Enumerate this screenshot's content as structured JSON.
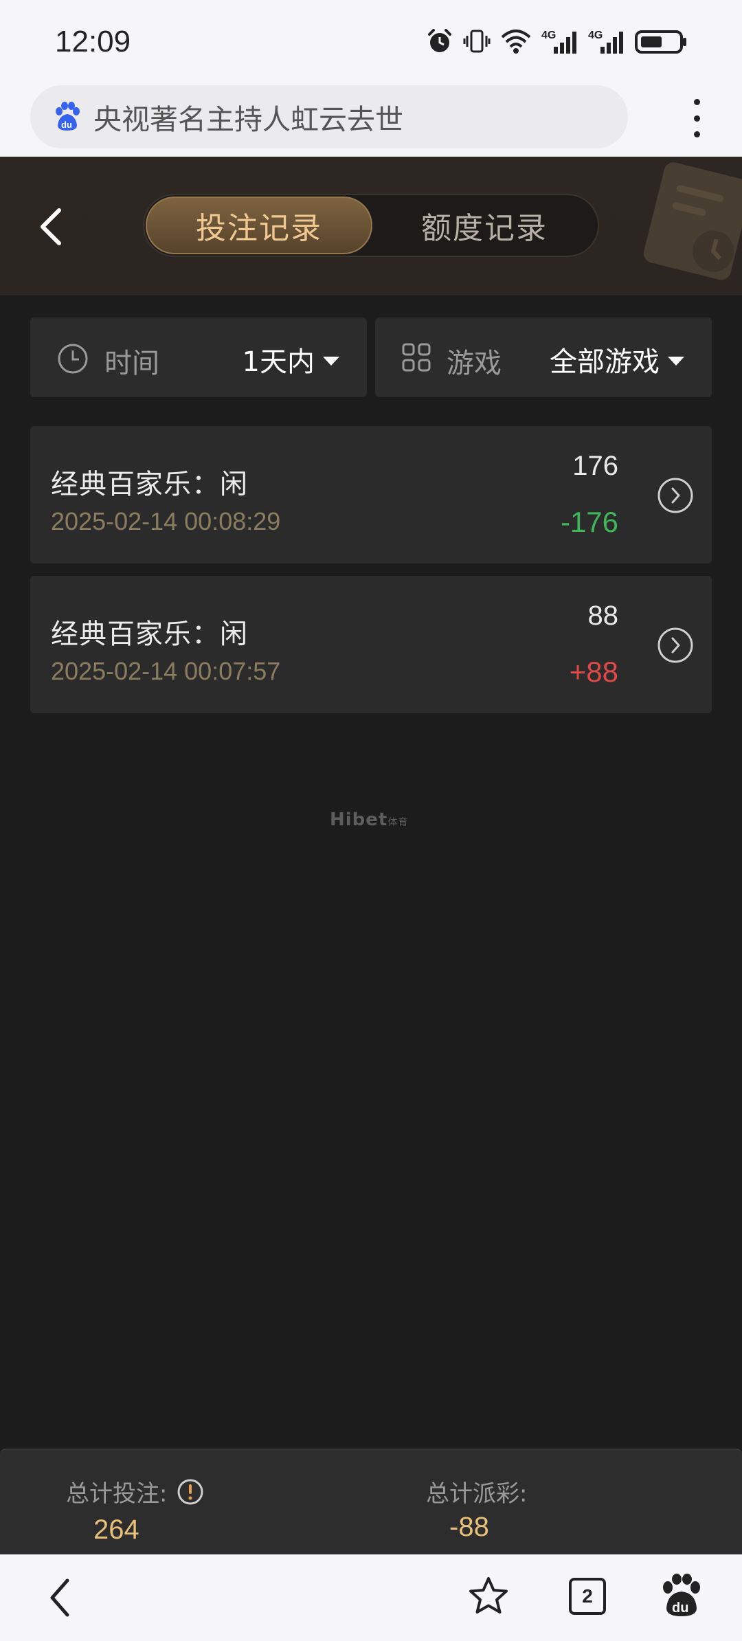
{
  "status_bar": {
    "time": "12:09",
    "icons": [
      "alarm-icon",
      "vibrate-icon",
      "wifi-icon",
      "signal-4g-icon",
      "signal-4g-icon",
      "battery-icon"
    ],
    "network_1": "4G",
    "network_2": "4G"
  },
  "browser": {
    "search_text": "央视著名主持人虹云去世",
    "tab_count": "2"
  },
  "header": {
    "tabs": [
      {
        "label": "投注记录",
        "active": true
      },
      {
        "label": "额度记录",
        "active": false
      }
    ]
  },
  "filters": {
    "time": {
      "label": "时间",
      "value": "1天内"
    },
    "game": {
      "label": "游戏",
      "value": "全部游戏"
    }
  },
  "records": [
    {
      "title": "经典百家乐：闲",
      "time": "2025-02-14 00:08:29",
      "bet": "176",
      "payout": "-176",
      "payout_color": "#3fb65a"
    },
    {
      "title": "经典百家乐：闲",
      "time": "2025-02-14 00:07:57",
      "bet": "88",
      "payout": "+88",
      "payout_color": "#e04848"
    }
  ],
  "watermark": {
    "text": "Hibet",
    "small": "体育"
  },
  "summary": {
    "total_bet_label": "总计投注:",
    "total_bet_value": "264",
    "total_payout_label": "总计派彩:",
    "total_payout_value": "-88"
  },
  "colors": {
    "accent_gold": "#e8c07a",
    "negative_green": "#3fb65a",
    "positive_red": "#e04848",
    "background": "#1c1c1c"
  }
}
